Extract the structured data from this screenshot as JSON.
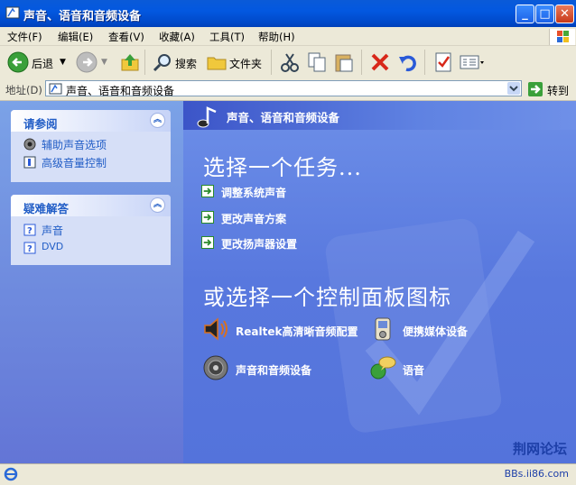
{
  "window": {
    "title": "声音、语音和音频设备"
  },
  "menu": [
    "文件(F)",
    "编辑(E)",
    "查看(V)",
    "收藏(A)",
    "工具(T)",
    "帮助(H)"
  ],
  "toolbar": {
    "back_label": "后退",
    "search_label": "搜索",
    "folders_label": "文件夹"
  },
  "address": {
    "label": "地址(D)",
    "value": "声音、语音和音频设备",
    "go_label": "转到"
  },
  "see_also": {
    "title": "请参阅",
    "items": [
      {
        "label": "辅助声音选项"
      },
      {
        "label": "高级音量控制"
      }
    ]
  },
  "troubleshoot": {
    "title": "疑难解答",
    "items": [
      {
        "label": "声音"
      },
      {
        "label": "DVD"
      }
    ]
  },
  "main": {
    "header": "声音、语音和音频设备",
    "pick_task": "选择一个任务...",
    "tasks": [
      {
        "label": "调整系统声音"
      },
      {
        "label": "更改声音方案"
      },
      {
        "label": "更改扬声器设置"
      }
    ],
    "pick_icon": "或选择一个控制面板图标",
    "icons": [
      {
        "label": "Realtek高清晰音频配置"
      },
      {
        "label": "便携媒体设备"
      },
      {
        "label": "声音和音频设备"
      },
      {
        "label": "语音"
      }
    ]
  },
  "watermark": {
    "line1": "荆网论坛",
    "line2": "BBs.ii86.com"
  }
}
